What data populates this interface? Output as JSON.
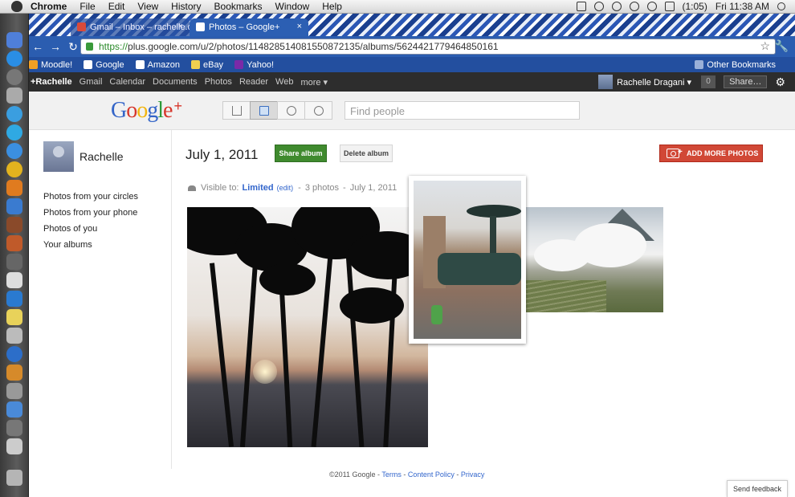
{
  "menubar": {
    "app_name": "Chrome",
    "items": [
      "File",
      "Edit",
      "View",
      "History",
      "Bookmarks",
      "Window",
      "Help"
    ],
    "battery": "(1:05)",
    "clock": "Fri 11:38 AM"
  },
  "browser": {
    "tabs": [
      {
        "title": "Gmail – Inbox – rachelle.dr",
        "close": "×"
      },
      {
        "title": "Photos – Google+",
        "close": "×"
      }
    ],
    "url_scheme": "https://",
    "url_rest": "plus.google.com/u/2/photos/114828514081550872135/albums/5624421779464850161",
    "bookmarks": [
      "Moodle!",
      "Google",
      "Amazon",
      "eBay",
      "Yahoo!"
    ],
    "other_bookmarks": "Other Bookmarks",
    "colors": {
      "toolbar": "#2b5db0",
      "tab_active": "#2c5fb3"
    }
  },
  "gbar": {
    "links": [
      "+Rachelle",
      "Gmail",
      "Calendar",
      "Documents",
      "Photos",
      "Reader",
      "Web",
      "more ▾"
    ],
    "user_name": "Rachelle Dragani ▾",
    "notification_count": "0",
    "share_label": "Share…"
  },
  "header": {
    "logo_letters": [
      "G",
      "o",
      "o",
      "g",
      "l",
      "e"
    ],
    "logo_plus": "+",
    "nav_icons": [
      "home-icon",
      "photos-icon",
      "profile-icon",
      "circles-icon"
    ],
    "find_people_placeholder": "Find people"
  },
  "sidebar": {
    "name": "Rachelle",
    "links": [
      "Photos from your circles",
      "Photos from your phone",
      "Photos of you",
      "Your albums"
    ]
  },
  "album": {
    "title": "July 1, 2011",
    "share_button": "Share album",
    "delete_button": "Delete album",
    "add_button": "ADD MORE PHOTOS",
    "visible_to_label": "Visible to:",
    "visibility": "Limited",
    "edit_label": "(edit)",
    "photo_count": "3 photos",
    "date": "July 1, 2011",
    "colors": {
      "share": "#3f8a2e",
      "add": "#d14836",
      "link": "#3366cc"
    }
  },
  "footer": {
    "copyright": "©2011 Google",
    "terms": "Terms",
    "content_policy": "Content Policy",
    "privacy": "Privacy",
    "separator": " - "
  },
  "feedback": "Send feedback"
}
